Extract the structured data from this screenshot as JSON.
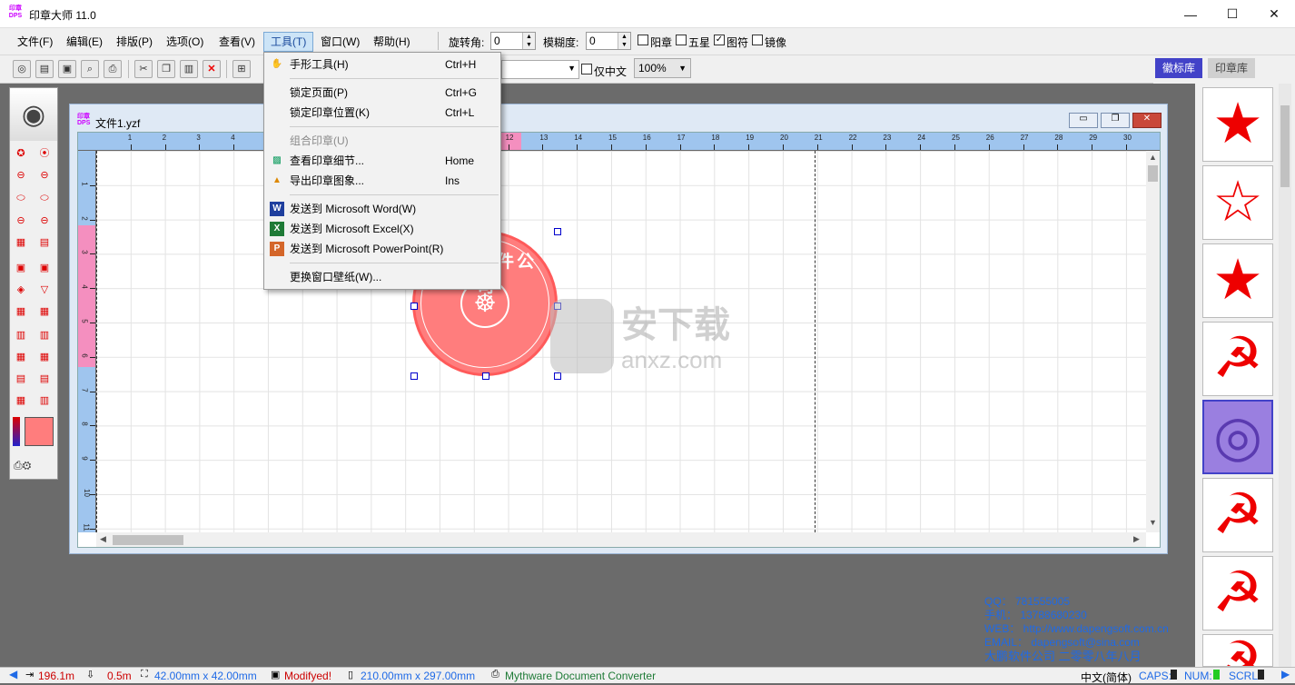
{
  "window": {
    "app_icon_text": "印章\nDPS",
    "title": "印章大师 11.0",
    "min": "—",
    "max": "☐",
    "close": "✕"
  },
  "menubar": [
    {
      "label": "文件(F)"
    },
    {
      "label": "编辑(E)"
    },
    {
      "label": "排版(P)"
    },
    {
      "label": "选项(O)"
    },
    {
      "label": "查看(V)"
    },
    {
      "label": "工具(T)"
    },
    {
      "label": "窗口(W)"
    },
    {
      "label": "帮助(H)"
    }
  ],
  "props": {
    "rotate_label": "旋转角:",
    "rotate_value": "0",
    "blur_label": "模糊度:",
    "blur_value": "0",
    "yang_label": "阳章",
    "five_star_label": "五星",
    "emblem_label": "图符",
    "mirror_label": "镜像",
    "cn_only_label": "仅中文",
    "zoom_value": "100%"
  },
  "tools_menu": {
    "hand_tool": {
      "label": "手形工具(H)",
      "shortcut": "Ctrl+H"
    },
    "lock_page": {
      "label": "锁定页面(P)",
      "shortcut": "Ctrl+G"
    },
    "lock_seal": {
      "label": "锁定印章位置(K)",
      "shortcut": "Ctrl+L"
    },
    "combine": {
      "label": "组合印章(U)"
    },
    "view_details": {
      "label": "查看印章细节...",
      "shortcut": "Home"
    },
    "export_image": {
      "label": "导出印章图象...",
      "shortcut": "Ins"
    },
    "send_word": {
      "label": "发送到 Microsoft Word(W)"
    },
    "send_excel": {
      "label": "发送到 Microsoft Excel(X)"
    },
    "send_ppt": {
      "label": "发送到 Microsoft PowerPoint(R)"
    },
    "change_wallpaper": {
      "label": "更换窗口壁纸(W)..."
    }
  },
  "doc": {
    "icon_text": "印章\nDPS",
    "title": "文件1.yzf"
  },
  "ruler_h_ticks": [
    "1",
    "2",
    "3",
    "4",
    "5",
    "6",
    "7",
    "8",
    "9",
    "10",
    "11",
    "12",
    "13",
    "14",
    "15",
    "16",
    "17",
    "18",
    "19",
    "20",
    "21",
    "22",
    "23",
    "24",
    "25",
    "26",
    "27",
    "28",
    "29",
    "30"
  ],
  "ruler_v_ticks": [
    "1",
    "2",
    "3",
    "4",
    "5",
    "6",
    "7",
    "8",
    "9",
    "10",
    "11"
  ],
  "seal": {
    "text": "政府软件公司"
  },
  "watermark": {
    "cn": "安下载",
    "en": "anxz.com"
  },
  "library": {
    "tab1": "徽标库",
    "tab2": "印章库",
    "items": [
      "★",
      "☆",
      "★",
      "☭",
      "◎",
      "☭",
      "☭",
      "☭"
    ]
  },
  "contact": {
    "qq": "QQ：  781555005",
    "phone": "手机：  13788680230",
    "web": "WEB：  http://www.dapengsoft.com.cn",
    "email": "EMAIL：  dapengsoft@sina.com",
    "company": "大鹏软件公司  二零零八年八月"
  },
  "status": {
    "x": "196.1m",
    "y": "0.5m",
    "size": "42.00mm x 42.00mm",
    "modified": "Modifyed!",
    "page": "210.00mm x 297.00mm",
    "printer": "Mythware Document Converter",
    "ime": "中文(简体)",
    "caps": "CAPS:",
    "num": "NUM:",
    "scrl": "SCRL:"
  },
  "colors": {
    "accent": "#cce4f7",
    "seal": "#ff7d7d",
    "ruler": "#9fc5ee",
    "ruler_sel": "#f48fbf",
    "contact": "#1f6ae6"
  }
}
